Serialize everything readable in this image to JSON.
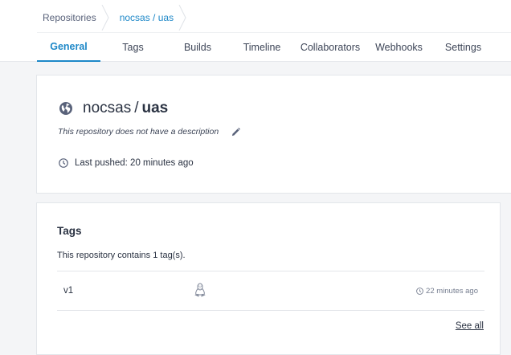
{
  "breadcrumb": {
    "items": [
      "Repositories",
      "nocsas / uas"
    ]
  },
  "tabs": [
    "General",
    "Tags",
    "Builds",
    "Timeline",
    "Collaborators",
    "Webhooks",
    "Settings"
  ],
  "active_tab": "General",
  "repo": {
    "namespace": "nocsas",
    "separator": "/",
    "name": "uas",
    "description": "This repository does not have a description",
    "last_pushed": "Last pushed: 20 minutes ago"
  },
  "tags_section": {
    "heading": "Tags",
    "count_text": "This repository contains 1 tag(s).",
    "rows": [
      {
        "name": "v1",
        "os_icon": "linux-icon",
        "time": "22 minutes ago"
      }
    ],
    "see_all": "See all"
  },
  "colors": {
    "accent": "#1e88c8",
    "text": "#2a3242",
    "background": "#f4f5f7"
  }
}
